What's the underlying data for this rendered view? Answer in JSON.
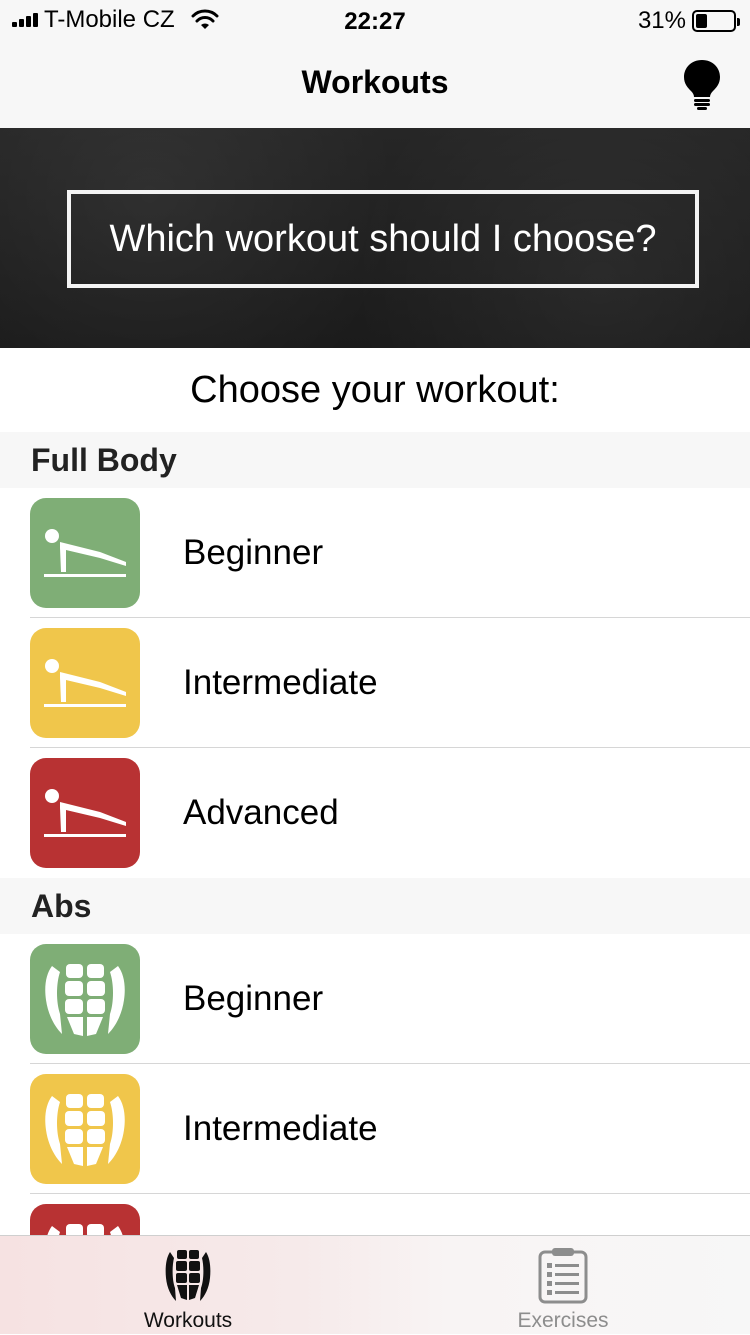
{
  "status_bar": {
    "carrier": "T-Mobile CZ",
    "time": "22:27",
    "battery_percent": "31%",
    "battery_level": 0.31
  },
  "nav": {
    "title": "Workouts",
    "right_icon": "lightbulb-icon"
  },
  "banner": {
    "text": "Which workout should I choose?"
  },
  "subtitle": "Choose your workout:",
  "sections": [
    {
      "title": "Full Body",
      "icon": "pushup-icon",
      "items": [
        {
          "label": "Beginner",
          "color": "#7fae76"
        },
        {
          "label": "Intermediate",
          "color": "#f0c64b"
        },
        {
          "label": "Advanced",
          "color": "#b83233"
        }
      ]
    },
    {
      "title": "Abs",
      "icon": "abs-icon",
      "items": [
        {
          "label": "Beginner",
          "color": "#7fae76"
        },
        {
          "label": "Intermediate",
          "color": "#f0c64b"
        },
        {
          "label": "",
          "color": "#b83233"
        }
      ]
    }
  ],
  "tab_bar": {
    "tabs": [
      {
        "label": "Workouts",
        "icon": "abs-icon",
        "selected": true
      },
      {
        "label": "Exercises",
        "icon": "clipboard-list-icon",
        "selected": false
      }
    ]
  }
}
